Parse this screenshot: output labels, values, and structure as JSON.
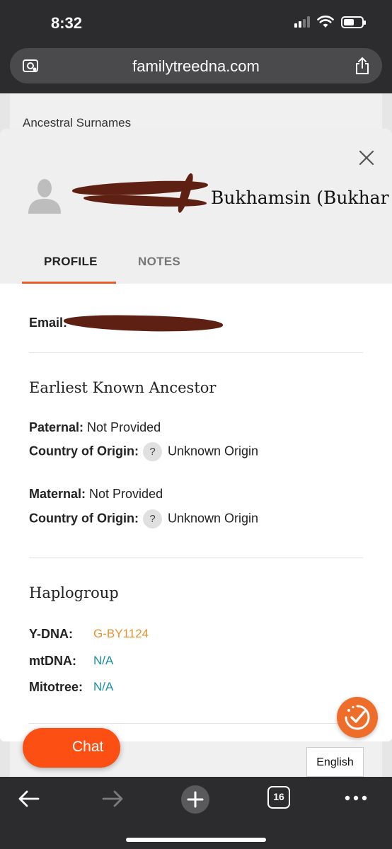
{
  "status": {
    "time": "8:32"
  },
  "browser": {
    "url": "familytreedna.com",
    "tab_count": "16"
  },
  "background": {
    "section_label": "Ancestral Surnames"
  },
  "modal": {
    "name_visible": "Bukhamsin (Bukhar",
    "tabs": [
      "PROFILE",
      "NOTES"
    ],
    "email_label": "Email:",
    "earliest": {
      "heading": "Earliest Known Ancestor",
      "paternal_label": "Paternal:",
      "paternal_value": "Not Provided",
      "country_label": "Country of Origin:",
      "country_value_1": "Unknown Origin",
      "maternal_label": "Maternal:",
      "maternal_value": "Not Provided",
      "country_value_2": "Unknown Origin",
      "help_glyph": "?"
    },
    "haplogroup": {
      "heading": "Haplogroup",
      "ydna_label": "Y-DNA:",
      "ydna_value": "G-BY1124",
      "mtdna_label": "mtDNA:",
      "mtdna_value": "N/A",
      "mitotree_label": "Mitotree:",
      "mitotree_value": "N/A"
    }
  },
  "chat_label": "Chat",
  "language_label": "English",
  "colors": {
    "accent": "#fb4f14",
    "ydna": "#e2922e",
    "link": "#1a8fa8",
    "redaction": "#5e2012"
  },
  "icons": [
    "camera-search-icon",
    "share-icon",
    "close-icon",
    "avatar-icon",
    "help-icon",
    "checklist-icon",
    "back-icon",
    "forward-icon",
    "add-tab-icon",
    "tabs-icon",
    "more-icon"
  ]
}
